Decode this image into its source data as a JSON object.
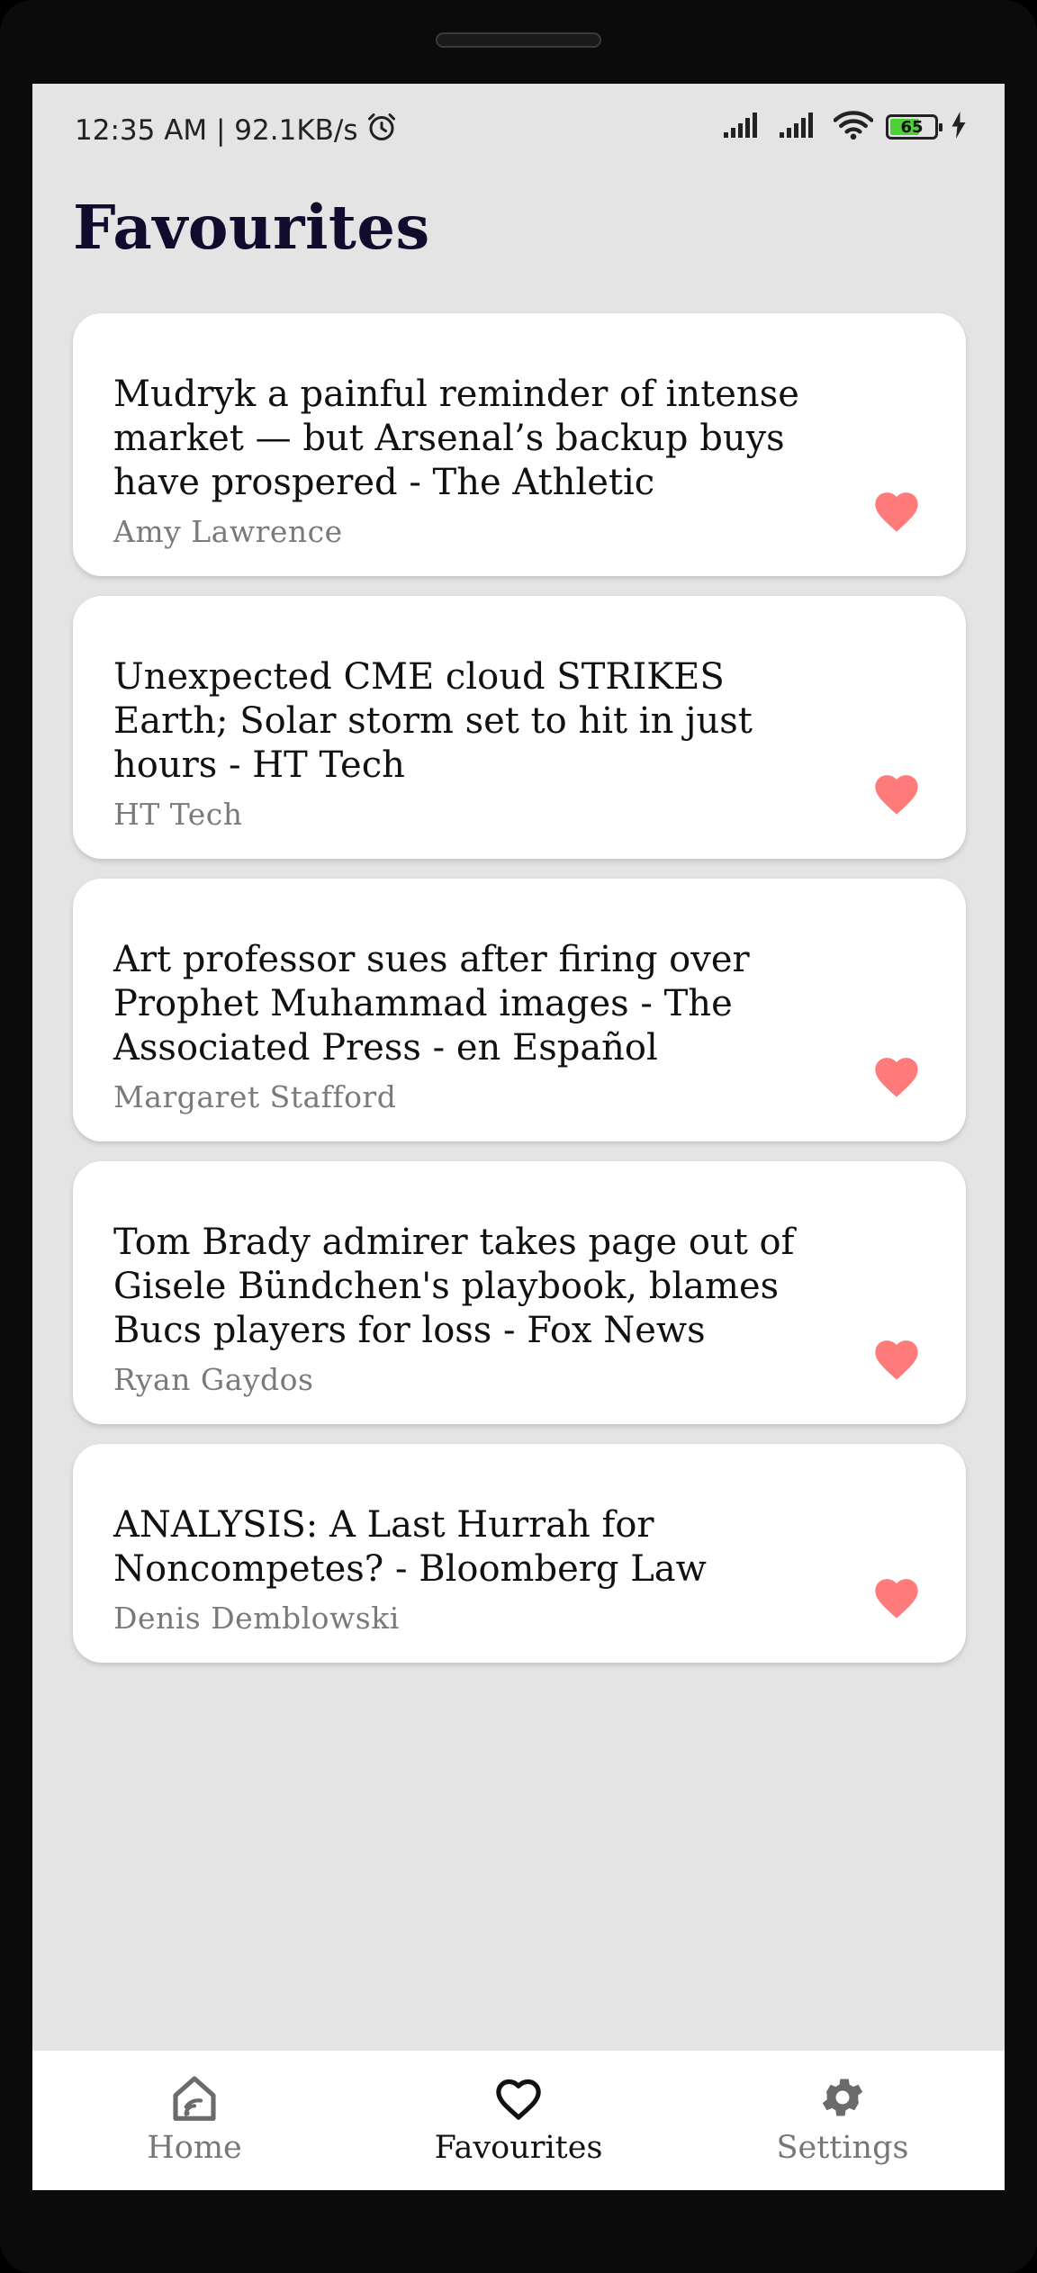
{
  "status_bar": {
    "time_speed": "12:35 AM | 92.1KB/s",
    "battery_level": "65",
    "icons": [
      "alarm-icon",
      "signal-icon",
      "signal-icon",
      "wifi-icon",
      "battery-icon",
      "charging-icon"
    ]
  },
  "page": {
    "title": "Favourites"
  },
  "colors": {
    "accent_heart": "#ff7b7b",
    "title": "#0f0c2e",
    "background": "#e4e4e4",
    "author": "#7a7a7a"
  },
  "favourites": [
    {
      "title": "Mudryk a painful reminder of intense market — but Arsenal’s backup buys have prospered - The Athletic",
      "author": "Amy Lawrence"
    },
    {
      "title": "Unexpected CME cloud STRIKES Earth; Solar storm set to hit in just hours - HT Tech",
      "author": "HT Tech"
    },
    {
      "title": "Art professor sues after firing over Prophet Muhammad images - The Associated Press - en Español",
      "author": "Margaret Stafford"
    },
    {
      "title": "Tom Brady admirer takes page out of Gisele Bündchen's playbook, blames Bucs players for loss - Fox News",
      "author": "Ryan Gaydos"
    },
    {
      "title": "ANALYSIS: A Last Hurrah for Noncompetes? - Bloomberg Law",
      "author": "Denis Demblowski"
    }
  ],
  "bottom_nav": {
    "items": [
      {
        "label": "Home",
        "icon": "home-icon",
        "active": false
      },
      {
        "label": "Favourites",
        "icon": "heart-outline-icon",
        "active": true
      },
      {
        "label": "Settings",
        "icon": "gear-icon",
        "active": false
      }
    ]
  }
}
